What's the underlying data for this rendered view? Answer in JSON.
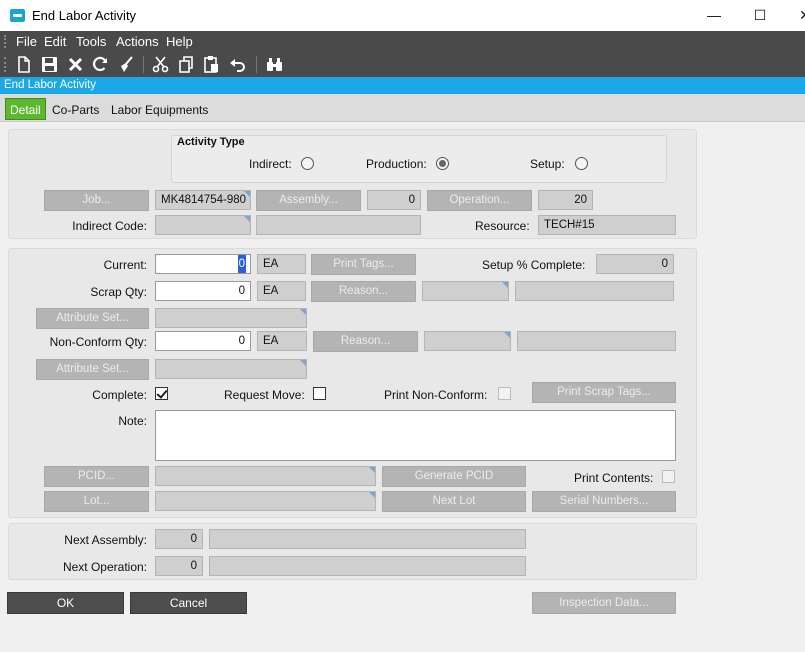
{
  "window": {
    "title": "End Labor Activity",
    "minimize": "—",
    "maximize": "☐",
    "close": "✕"
  },
  "menu": [
    "File",
    "Edit",
    "Tools",
    "Actions",
    "Help"
  ],
  "toolbar_icons": [
    "new-icon",
    "save-icon",
    "delete-icon",
    "refresh-icon",
    "clear-icon",
    "cut-icon",
    "copy-icon",
    "paste-icon",
    "undo-icon",
    "search-icon"
  ],
  "form_title": "End Labor Activity",
  "tabs": [
    "Detail",
    "Co-Parts",
    "Labor Equipments"
  ],
  "activity_type": {
    "title": "Activity Type",
    "indirect": "Indirect:",
    "production": "Production:",
    "setup": "Setup:",
    "selected": "production"
  },
  "header": {
    "job_button": "Job...",
    "job_value": "MK4814754-980",
    "assembly_button": "Assembly...",
    "assembly_value": "0",
    "operation_button": "Operation...",
    "operation_value": "20",
    "indirect_code_label": "Indirect Code:",
    "resource_label": "Resource:",
    "resource_value": "TECH#15"
  },
  "quantities": {
    "current_label": "Current:",
    "current_value": "0",
    "current_uom": "EA",
    "print_tags_button": "Print Tags...",
    "setup_complete_label": "Setup % Complete:",
    "setup_complete_value": "0",
    "scrap_label": "Scrap Qty:",
    "scrap_value": "0",
    "scrap_uom": "EA",
    "reason_button_1": "Reason...",
    "attribute_set_button_1": "Attribute Set...",
    "nonconform_label": "Non-Conform Qty:",
    "nonconform_value": "0",
    "nonconform_uom": "EA",
    "reason_button_2": "Reason...",
    "attribute_set_button_2": "Attribute Set...",
    "complete_label": "Complete:",
    "complete_checked": true,
    "request_move_label": "Request Move:",
    "print_nonconform_label": "Print Non-Conform:",
    "print_scrap_tags_button": "Print Scrap Tags...",
    "note_label": "Note:",
    "note_value": "",
    "pcid_button": "PCID...",
    "generate_pcid_button": "Generate PCID",
    "print_contents_label": "Print Contents:",
    "lot_button": "Lot...",
    "next_lot_button": "Next Lot",
    "serial_numbers_button": "Serial Numbers..."
  },
  "next": {
    "next_assembly_label": "Next Assembly:",
    "next_assembly_value": "0",
    "next_operation_label": "Next Operation:",
    "next_operation_value": "0"
  },
  "footer": {
    "ok": "OK",
    "cancel": "Cancel",
    "inspection_data": "Inspection Data..."
  }
}
